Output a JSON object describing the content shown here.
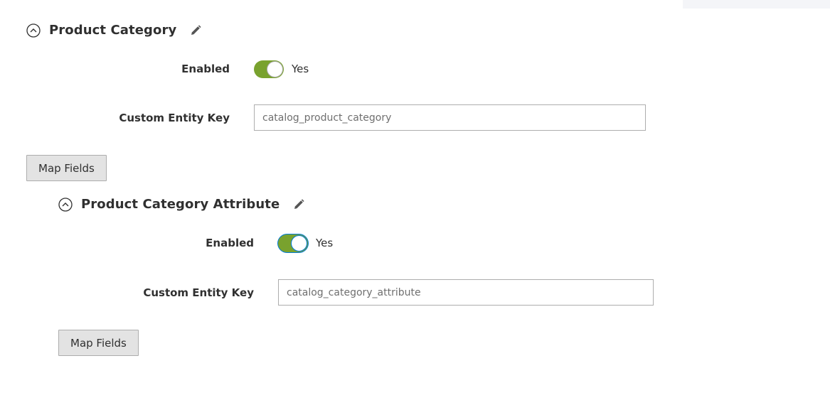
{
  "section1": {
    "title": "Product Category",
    "enabled_label": "Enabled",
    "enabled_value": "Yes",
    "entity_key_label": "Custom Entity Key",
    "entity_key_value": "catalog_product_category",
    "map_fields_label": "Map Fields",
    "collapse_icon": "chevron-up-circle-icon",
    "edit_icon": "pencil-icon"
  },
  "section2": {
    "title": "Product Category Attribute",
    "enabled_label": "Enabled",
    "enabled_value": "Yes",
    "entity_key_label": "Custom Entity Key",
    "entity_key_value": "catalog_category_attribute",
    "map_fields_label": "Map Fields",
    "collapse_icon": "chevron-up-circle-icon",
    "edit_icon": "pencil-icon"
  },
  "colors": {
    "toggle_on": "#79a22e",
    "focus": "#007bdb",
    "button_bg": "#e3e3e3"
  }
}
